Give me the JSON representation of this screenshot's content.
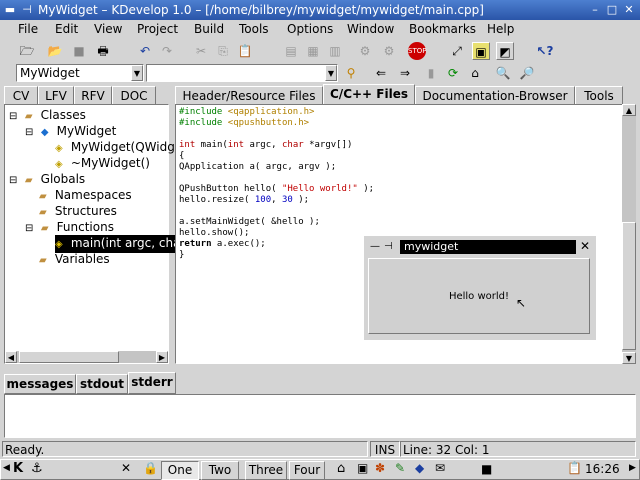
{
  "window": {
    "title": "MyWidget – KDevelop 1.0 – [/home/bilbrey/mywidget/mywidget/main.cpp]"
  },
  "menu": [
    "File",
    "Edit",
    "View",
    "Project",
    "Build",
    "Tools",
    "Options",
    "Window",
    "Bookmarks",
    "Help"
  ],
  "toolbar2": {
    "class_combo": "MyWidget",
    "method_combo": ""
  },
  "left_tabs": [
    "CV",
    "LFV",
    "RFV",
    "DOC"
  ],
  "tree": {
    "classes": "Classes",
    "mywidget": "MyWidget",
    "ctor": "MyWidget(QWidg",
    "dtor": "~MyWidget()",
    "globals": "Globals",
    "namespaces": "Namespaces",
    "structures": "Structures",
    "functions": "Functions",
    "main_fn": "main(int argc, cha",
    "variables": "Variables"
  },
  "editor_tabs": [
    "Header/Resource Files",
    "C/C++ Files",
    "Documentation-Browser",
    "Tools"
  ],
  "code": {
    "l1a": "#include ",
    "l1b": "<qapplication.h>",
    "l2a": "#include ",
    "l2b": "<qpushbutton.h>",
    "l3a": "int",
    "l3b": " main(",
    "l3c": "int",
    "l3d": " argc, ",
    "l3e": "char",
    "l3f": " *argv[])",
    "l4": "{",
    "l5": "QApplication a( argc, argv );",
    "l6a": "QPushButton hello( ",
    "l6b": "\"Hello world!\"",
    "l6c": " );",
    "l7a": "hello.resize( ",
    "l7b": "100",
    "l7c": ", ",
    "l7d": "30",
    "l7e": " );",
    "l8": "a.setMainWidget( &hello );",
    "l9": "hello.show();",
    "l10a": "return",
    "l10b": " a.exec();",
    "l11": "}"
  },
  "child_window": {
    "title": "mywidget",
    "button": "Hello world!"
  },
  "bottom_tabs": [
    "messages",
    "stdout",
    "stderr"
  ],
  "status": {
    "left": "Ready.",
    "ins": "INS",
    "line": "Line: 32 Col: 1"
  },
  "taskbar": {
    "desktops": [
      "One",
      "Two",
      "Three",
      "Four"
    ],
    "clock": "16:26"
  }
}
